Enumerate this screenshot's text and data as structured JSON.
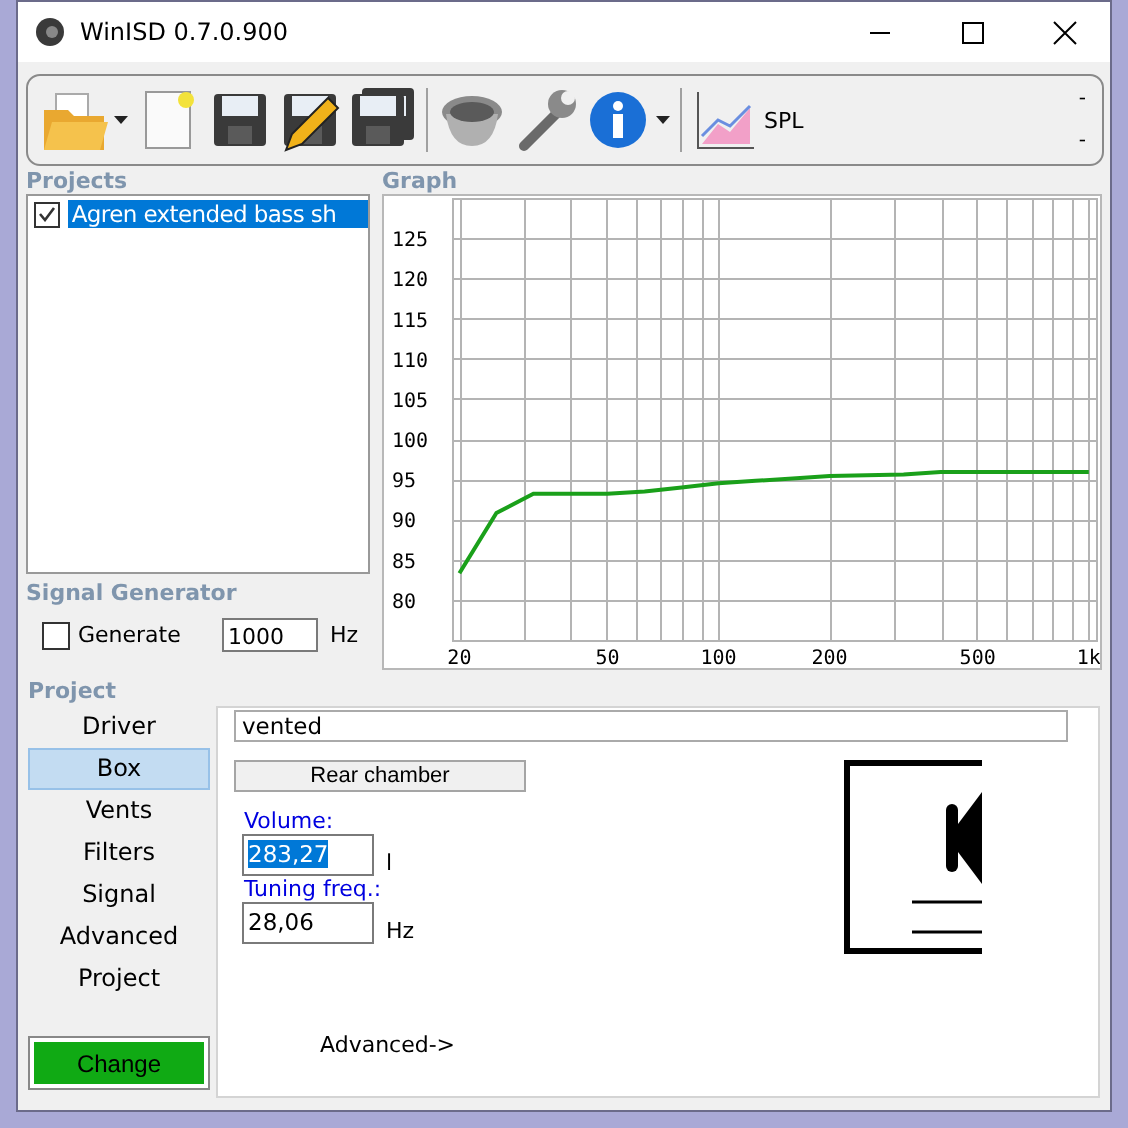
{
  "window": {
    "title": "WinISD 0.7.0.900"
  },
  "toolbar": {
    "label": "SPL",
    "indicators": [
      "-",
      "-"
    ]
  },
  "projects": {
    "label": "Projects",
    "items": [
      {
        "name": "Agren extended bass sh",
        "checked": true,
        "selected": true
      }
    ]
  },
  "graph": {
    "label": "Graph",
    "chart_data": {
      "type": "line",
      "grid": true,
      "ylim": [
        75,
        130
      ],
      "categories": [
        "20",
        null,
        null,
        null,
        "50",
        null,
        null,
        "100",
        null,
        null,
        "200",
        null,
        null,
        null,
        "500",
        null,
        null,
        "1k"
      ],
      "yticks": [
        80,
        85,
        90,
        95,
        100,
        105,
        110,
        115,
        120,
        125
      ],
      "series": [
        {
          "color": "#1aa01a",
          "values": [
            83.3,
            90.8,
            93.2,
            93.2,
            93.2,
            93.5,
            94,
            94.5,
            94.8,
            95.1,
            95.4,
            95.5,
            95.6,
            95.9,
            95.9,
            95.9,
            95.9,
            95.9
          ]
        }
      ]
    }
  },
  "signal_generator": {
    "label": "Signal Generator",
    "generate": {
      "label": "Generate",
      "checked": false
    },
    "frequency": "1000",
    "unit": "Hz"
  },
  "project": {
    "label": "Project",
    "nav": [
      {
        "label": "Driver",
        "selected": false
      },
      {
        "label": "Box",
        "selected": true
      },
      {
        "label": "Vents",
        "selected": false
      },
      {
        "label": "Filters",
        "selected": false
      },
      {
        "label": "Signal",
        "selected": false
      },
      {
        "label": "Advanced",
        "selected": false
      },
      {
        "label": "Project",
        "selected": false
      }
    ],
    "change_button": "Change",
    "box_type": "vented",
    "chamber_button": "Rear chamber",
    "fields": [
      {
        "label": "Volume:",
        "value": "283,27",
        "unit": "l",
        "highlighted": true
      },
      {
        "label": "Tuning freq.:",
        "value": "28,06",
        "unit": "Hz",
        "highlighted": false
      }
    ],
    "advanced_link": "Advanced->"
  }
}
